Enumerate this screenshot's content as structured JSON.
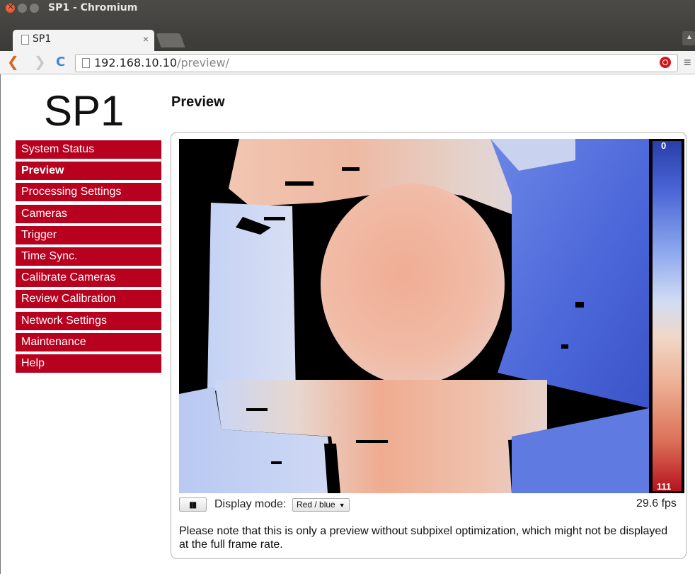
{
  "window": {
    "title": "SP1 - Chromium"
  },
  "tab": {
    "label": "SP1",
    "close": "×"
  },
  "toolbar": {
    "url_host": "192.168.10.10",
    "url_path": "/preview/"
  },
  "logo": "SP1",
  "sidebar": {
    "items": [
      {
        "label": "System Status"
      },
      {
        "label": "Preview"
      },
      {
        "label": "Processing Settings"
      },
      {
        "label": "Cameras"
      },
      {
        "label": "Trigger"
      },
      {
        "label": "Time Sync."
      },
      {
        "label": "Calibrate Cameras"
      },
      {
        "label": "Review Calibration"
      },
      {
        "label": "Network Settings"
      },
      {
        "label": "Maintenance"
      },
      {
        "label": "Help"
      }
    ]
  },
  "page": {
    "heading": "Preview",
    "scale_min": "0",
    "scale_max": "111",
    "pause_label": "▮▮",
    "display_mode_label": "Display mode:",
    "display_mode_value": "Red / blue",
    "fps": "29.6 fps",
    "note": "Please note that this is only a preview without subpixel optimization, which might not be displayed at the full frame rate."
  },
  "colors": {
    "accent": "#b8001f",
    "scale_low": "#2a3ea8",
    "scale_high": "#b8121f"
  },
  "icons": {
    "back": "back-arrow-icon",
    "forward": "forward-arrow-icon",
    "reload": "reload-icon",
    "bookmark": "star-icon",
    "menu": "hamburger-menu-icon"
  }
}
